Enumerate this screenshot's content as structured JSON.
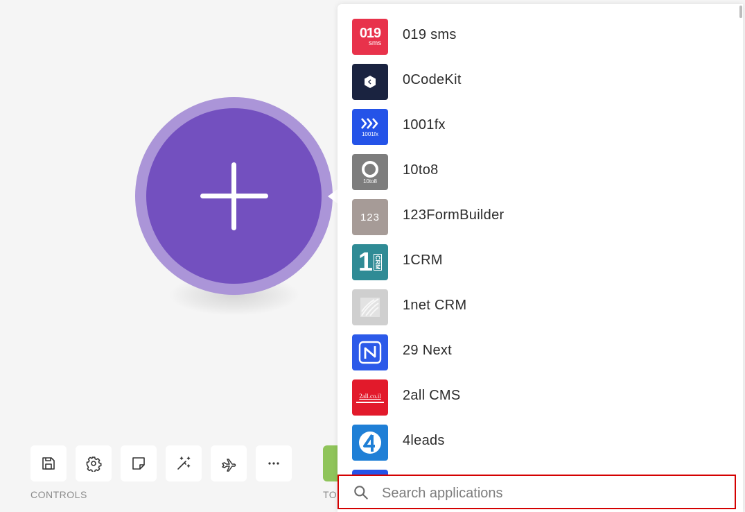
{
  "canvas": {
    "add_module_color": "#7350bf",
    "add_module_ring_color": "#ab95d8"
  },
  "toolbar": {
    "controls_label": "CONTROLS",
    "tools_label": "TOOLS",
    "buttons": [
      {
        "name": "save",
        "icon": "save-icon"
      },
      {
        "name": "settings",
        "icon": "gear-icon"
      },
      {
        "name": "notes",
        "icon": "note-icon"
      },
      {
        "name": "auto-align",
        "icon": "magic-wand-icon"
      },
      {
        "name": "explain-flow",
        "icon": "airplane-icon"
      },
      {
        "name": "more",
        "icon": "more-icon"
      }
    ],
    "tools_color": "#8fc45a"
  },
  "app_panel": {
    "apps": [
      {
        "name": "019 sms",
        "logo_text": "019",
        "logo_sub": "sms",
        "color": "#e8324b"
      },
      {
        "name": "0CodeKit",
        "logo_text": "",
        "color": "#1a2340"
      },
      {
        "name": "1001fx",
        "logo_text": "1001fx",
        "color": "#2453e8"
      },
      {
        "name": "10to8",
        "logo_text": "10to8",
        "color": "#7d7d7d"
      },
      {
        "name": "123FormBuilder",
        "logo_text": "123",
        "color": "#a69b97"
      },
      {
        "name": "1CRM",
        "logo_text": "1",
        "logo_sub": "CRM",
        "color": "#2f8b95"
      },
      {
        "name": "1net CRM",
        "logo_text": "",
        "color": "#cfcfcf"
      },
      {
        "name": "29 Next",
        "logo_text": "",
        "color": "#2c5ae9"
      },
      {
        "name": "2all CMS",
        "logo_text": "2all.co.il",
        "color": "#e21a2b"
      },
      {
        "name": "4leads",
        "logo_text": "",
        "color": "#1f7fd6"
      }
    ],
    "search": {
      "placeholder": "Search applications",
      "value": ""
    }
  }
}
